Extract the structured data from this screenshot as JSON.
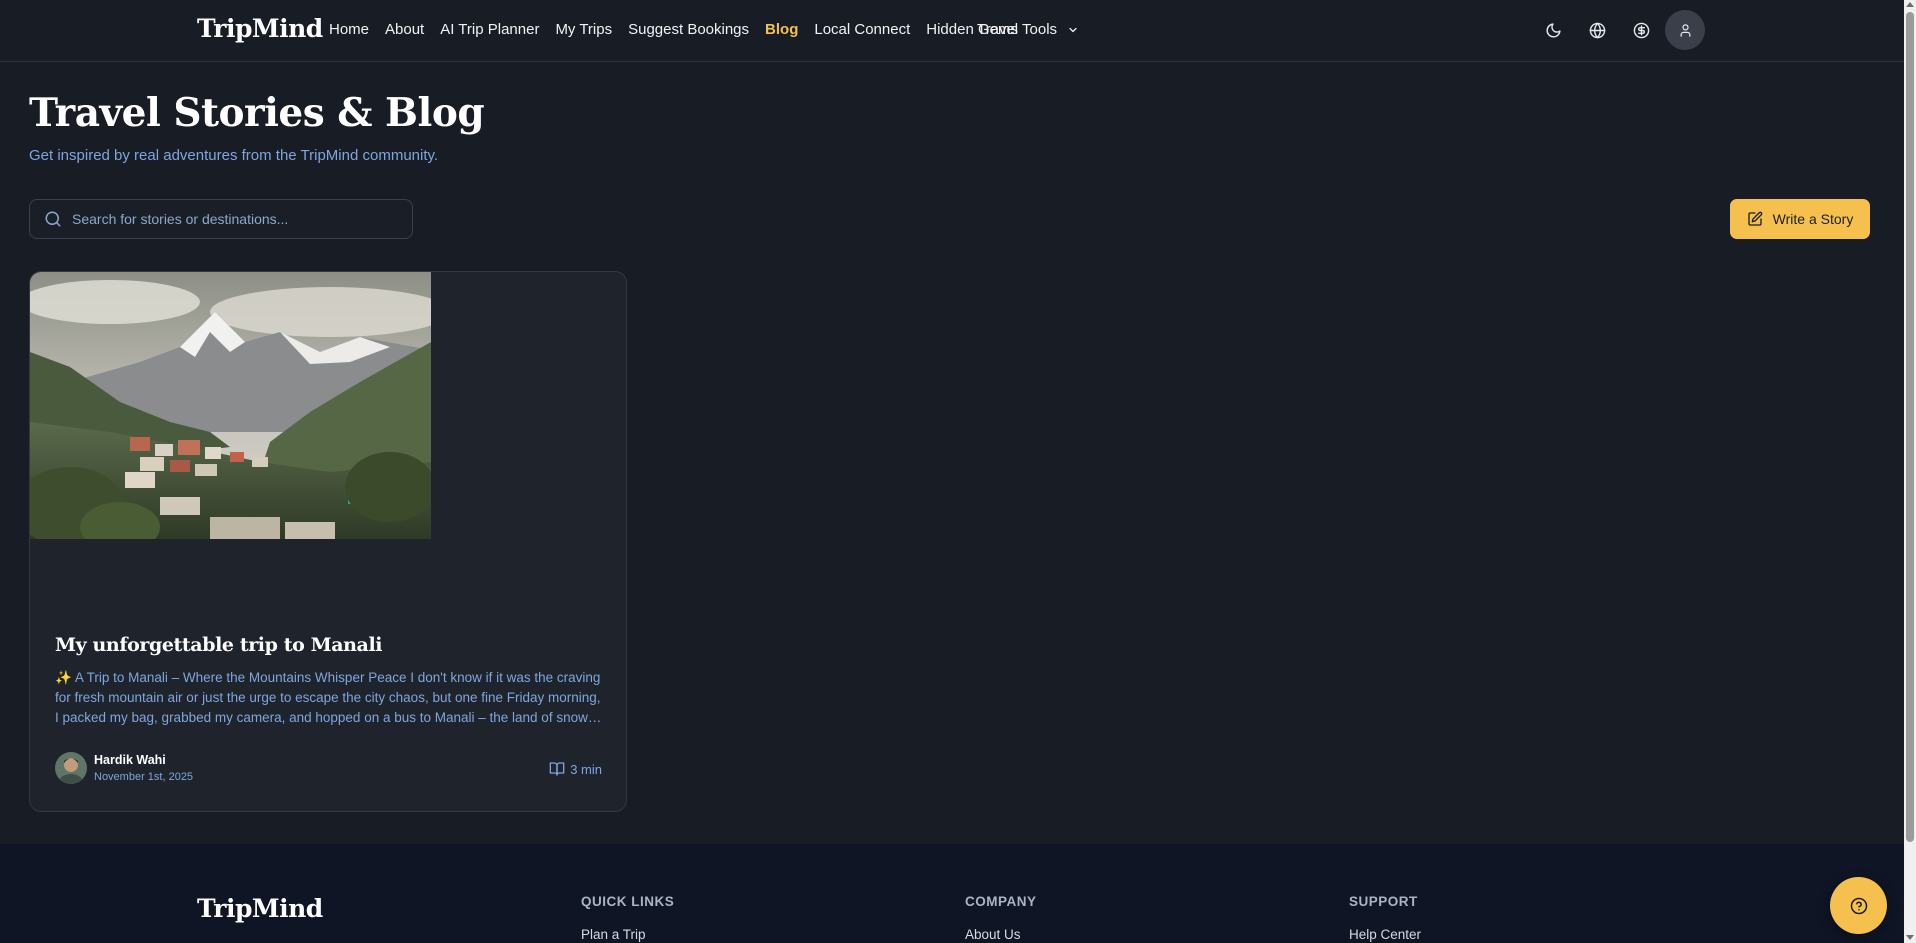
{
  "nav": {
    "brand": "TripMind",
    "links": [
      "Home",
      "About",
      "AI Trip Planner",
      "My Trips",
      "Suggest Bookings",
      "Blog",
      "Local Connect",
      "Hidden Gems"
    ],
    "active": "Blog",
    "travel_tools": "Travel Tools",
    "icons": [
      "moon-icon",
      "globe-icon",
      "dollar-icon",
      "user-icon"
    ]
  },
  "header": {
    "title": "Travel Stories & Blog",
    "subtitle": "Get inspired by real adventures from the TripMind community."
  },
  "search": {
    "placeholder": "Search for stories or destinations..."
  },
  "write_button": {
    "label": "Write a Story",
    "icon": "edit-icon"
  },
  "posts": [
    {
      "title": "My unforgettable trip to Manali",
      "excerpt": "✨ A Trip to Manali – Where the Mountains Whisper Peace I don't know if it was the craving for fresh mountain air or just the urge to escape the city chaos, but one fine Friday morning, I packed my bag, grabbed my camera, and hopped on a bus to Manali – the land of snow-capped peaks and pine forests.",
      "author": "Hardik Wahi",
      "date": "November 1st, 2025",
      "read_time": "3 min"
    }
  ],
  "footer": {
    "brand": "TripMind",
    "columns": [
      {
        "heading": "QUICK LINKS",
        "first_link": "Plan a Trip"
      },
      {
        "heading": "COMPANY",
        "first_link": "About Us"
      },
      {
        "heading": "SUPPORT",
        "first_link": "Help Center"
      }
    ]
  },
  "colors": {
    "background": "#181c24",
    "card": "#1f232c",
    "accent": "#f6c04f",
    "link_muted": "#7ea6dd",
    "footer": "#0f1525"
  }
}
